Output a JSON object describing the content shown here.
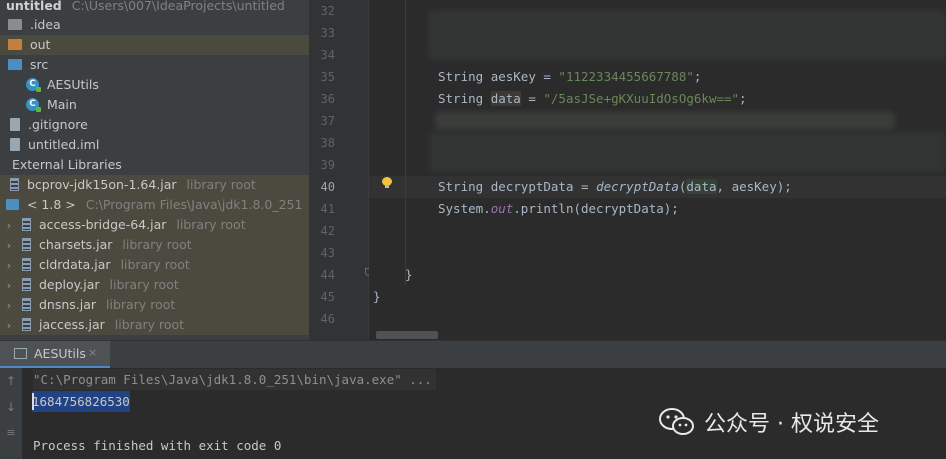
{
  "project_tree": {
    "root_name": "untitled",
    "root_path": "C:\\Users\\007\\IdeaProjects\\untitled",
    "items": [
      {
        "label": ".idea",
        "icon": "folder-icon"
      },
      {
        "label": "out",
        "icon": "folder-icon"
      },
      {
        "label": "src",
        "icon": "folder-icon"
      },
      {
        "label": "AESUtils",
        "icon": "java-class-icon"
      },
      {
        "label": "Main",
        "icon": "java-class-icon"
      },
      {
        "label": ".gitignore",
        "icon": "file-icon"
      },
      {
        "label": "untitled.iml",
        "icon": "file-icon"
      }
    ],
    "external_libraries": "External Libraries",
    "libraries": [
      {
        "name": "bcprov-jdk15on-1.64.jar",
        "tag": "library root"
      }
    ],
    "jdk": {
      "name": "< 1.8 >",
      "path": "C:\\Program Files\\Java\\jdk1.8.0_251"
    },
    "jdk_jars": [
      {
        "name": "access-bridge-64.jar",
        "tag": "library root"
      },
      {
        "name": "charsets.jar",
        "tag": "library root"
      },
      {
        "name": "cldrdata.jar",
        "tag": "library root"
      },
      {
        "name": "deploy.jar",
        "tag": "library root"
      },
      {
        "name": "dnsns.jar",
        "tag": "library root"
      },
      {
        "name": "jaccess.jar",
        "tag": "library root"
      }
    ]
  },
  "editor": {
    "line_numbers": [
      "32",
      "33",
      "34",
      "35",
      "36",
      "37",
      "38",
      "39",
      "40",
      "41",
      "42",
      "43",
      "44",
      "45",
      "46"
    ],
    "current_line": "40",
    "code": {
      "l35_type": "String",
      "l35_var": "aesKey",
      "l35_eq": " = ",
      "l35_str": "\"1122334455667788\"",
      "l35_end": ";",
      "l36_type": "String",
      "l36_var": "data",
      "l36_eq": " = ",
      "l36_str": "\"/5asJSe+gKXuuIdOsOg6kw==\"",
      "l36_end": ";",
      "l40_type": "String",
      "l40_var": "decryptData",
      "l40_eq": " = ",
      "l40_call": "decryptData",
      "l40_open": "(",
      "l40_arg1": "data",
      "l40_comma": ", ",
      "l40_arg2": "aesKey",
      "l40_close": ");",
      "l41_sys": "System.",
      "l41_out": "out",
      "l41_rest": ".println(decryptData);",
      "l44": "}",
      "l45": "}"
    }
  },
  "run_panel": {
    "tab_label": "AESUtils",
    "tab_close": "×",
    "command": "\"C:\\Program Files\\Java\\jdk1.8.0_251\\bin\\java.exe\" ...",
    "output": "1684756826530",
    "exit_message": "Process finished with exit code 0"
  },
  "watermark": {
    "text": "公众号 · 权说安全"
  }
}
